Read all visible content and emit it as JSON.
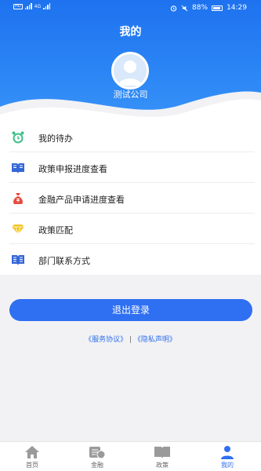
{
  "status_bar": {
    "network": "4G",
    "battery": "88%",
    "time": "14:29"
  },
  "header": {
    "title": "我的",
    "company_name": "测试公司"
  },
  "menu": [
    {
      "label": "我的待办",
      "icon": "alarm-clock-icon"
    },
    {
      "label": "政策申报进度查看",
      "icon": "open-book-icon"
    },
    {
      "label": "金融产品申请进度查看",
      "icon": "money-bag-icon"
    },
    {
      "label": "政策匹配",
      "icon": "diamond-icon"
    },
    {
      "label": "部门联系方式",
      "icon": "book-icon"
    }
  ],
  "logout_label": "退出登录",
  "agreement_links": {
    "service": "《服务协议》",
    "separator": " | ",
    "privacy": "《隐私声明》"
  },
  "tabbar": [
    {
      "label": "首页",
      "icon": "home-icon"
    },
    {
      "label": "金融",
      "icon": "finance-icon"
    },
    {
      "label": "政策",
      "icon": "policy-book-icon"
    },
    {
      "label": "我的",
      "icon": "profile-icon"
    }
  ],
  "colors": {
    "primary": "#2f6ff2",
    "header": "#1e72ef",
    "alarm": "#3fbf8a",
    "bag": "#e84b3c",
    "diamond": "#f3c521",
    "book": "#3466d6"
  }
}
